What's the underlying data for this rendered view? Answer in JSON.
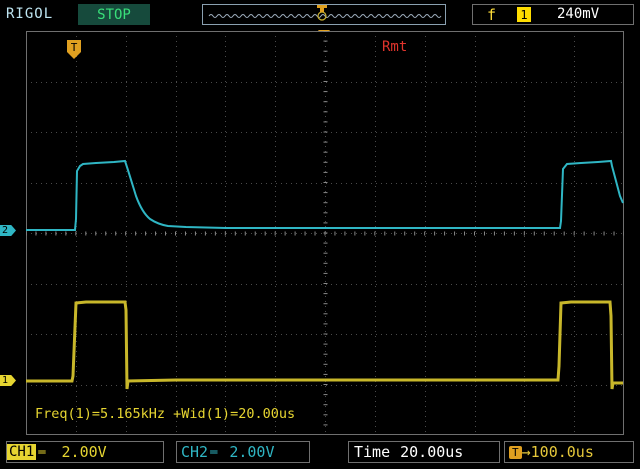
{
  "header": {
    "brand": "RIGOL",
    "run_status": "STOP",
    "trigger_edge_glyph": "f",
    "trigger_edge_icon": "rising-edge-trigger-icon",
    "trigger_source": "1",
    "trigger_level": "240mV"
  },
  "screen": {
    "remote_label": "Rmt",
    "trigger_marker": "T",
    "measurements": "Freq(1)=5.165kHz  +Wid(1)=20.00us"
  },
  "channel_markers": {
    "ch2": "2",
    "ch1": "1"
  },
  "footer": {
    "ch1_tag": "CH1",
    "ch1_scale": "2.00V",
    "ch2_tag": "CH2",
    "ch2_scale": "2.00V",
    "coupling_symbol": "═",
    "time_label": "Time",
    "time_scale": "20.00us",
    "trigger_offset_label": "T",
    "trigger_offset": "→100.0us"
  },
  "colors": {
    "ch1": "#e6d531",
    "ch2": "#2fb6c4",
    "grid": "#4a4a4a",
    "remote": "#e0342c"
  }
}
